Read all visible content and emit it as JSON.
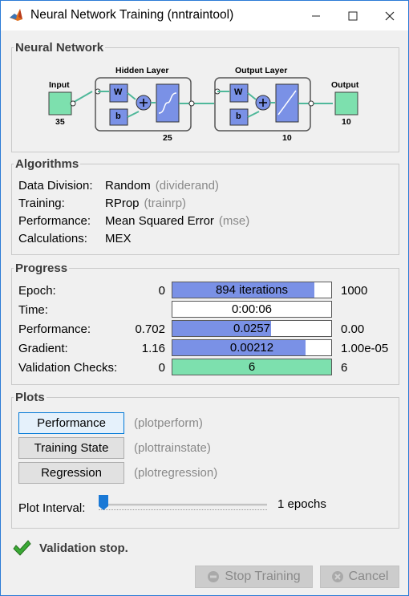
{
  "window": {
    "title": "Neural Network Training (nntraintool)",
    "icons": [
      "matlab-icon",
      "minimize-icon",
      "maximize-icon",
      "close-icon"
    ]
  },
  "network": {
    "section_title": "Neural Network",
    "input_label": "Input",
    "input_size": "35",
    "hidden_label": "Hidden Layer",
    "hidden_size": "25",
    "output_layer_label": "Output Layer",
    "output_layer_size": "10",
    "output_label": "Output",
    "output_size": "10",
    "w_label": "W",
    "b_label": "b",
    "plus": "+"
  },
  "algorithms": {
    "section_title": "Algorithms",
    "rows": [
      {
        "label": "Data Division:",
        "value": "Random",
        "hint": "(dividerand)"
      },
      {
        "label": "Training:",
        "value": "RProp",
        "hint": "(trainrp)"
      },
      {
        "label": "Performance:",
        "value": "Mean Squared Error",
        "hint": "(mse)"
      },
      {
        "label": "Calculations:",
        "value": "MEX",
        "hint": ""
      }
    ]
  },
  "progress": {
    "section_title": "Progress",
    "rows": [
      {
        "label": "Epoch:",
        "start": "0",
        "bar_text": "894 iterations",
        "fill": 0.894,
        "end": "1000"
      },
      {
        "label": "Time:",
        "start": "",
        "bar_text": "0:00:06",
        "fill": 0,
        "end": ""
      },
      {
        "label": "Performance:",
        "start": "0.702",
        "bar_text": "0.0257",
        "fill": 0.62,
        "end": "0.00"
      },
      {
        "label": "Gradient:",
        "start": "1.16",
        "bar_text": "0.00212",
        "fill": 0.84,
        "end": "1.00e-05"
      },
      {
        "label": "Validation Checks:",
        "start": "0",
        "bar_text": "6",
        "fill": 1.0,
        "end": "6"
      }
    ]
  },
  "plots": {
    "section_title": "Plots",
    "buttons": [
      {
        "label": "Performance",
        "hint": "(plotperform)"
      },
      {
        "label": "Training State",
        "hint": "(plottrainstate)"
      },
      {
        "label": "Regression",
        "hint": "(plotregression)"
      }
    ],
    "interval_label": "Plot Interval:",
    "interval_value": "1 epochs",
    "slider_level": 0
  },
  "status": {
    "text": "Validation stop.",
    "icon": "checkmark-icon"
  },
  "footer": {
    "stop_label": "Stop Training",
    "cancel_label": "Cancel"
  },
  "colors": {
    "bar_fill": "#7a91e6",
    "validation_fill": "#7de0ae",
    "node_green": "#7de0ae",
    "block_blue": "#7a91e6"
  }
}
